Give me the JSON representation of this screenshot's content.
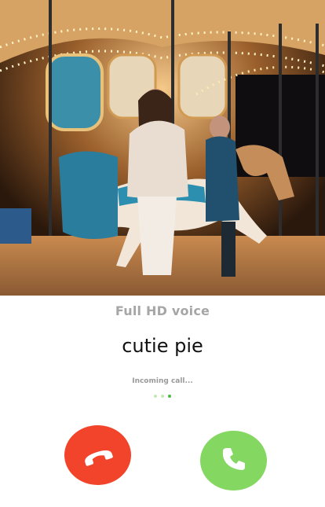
{
  "call": {
    "quality_label": "Full HD voice",
    "caller_name": "cutie pie",
    "status_text": "Incoming call...",
    "progress_dots": 3,
    "active_dot": 3
  },
  "buttons": {
    "decline_icon": "phone-hangup-icon",
    "accept_icon": "phone-answer-icon"
  },
  "colors": {
    "decline": "#f2442b",
    "accept": "#84d760",
    "quality_label": "#a6a6a6",
    "caller_name": "#111111"
  }
}
